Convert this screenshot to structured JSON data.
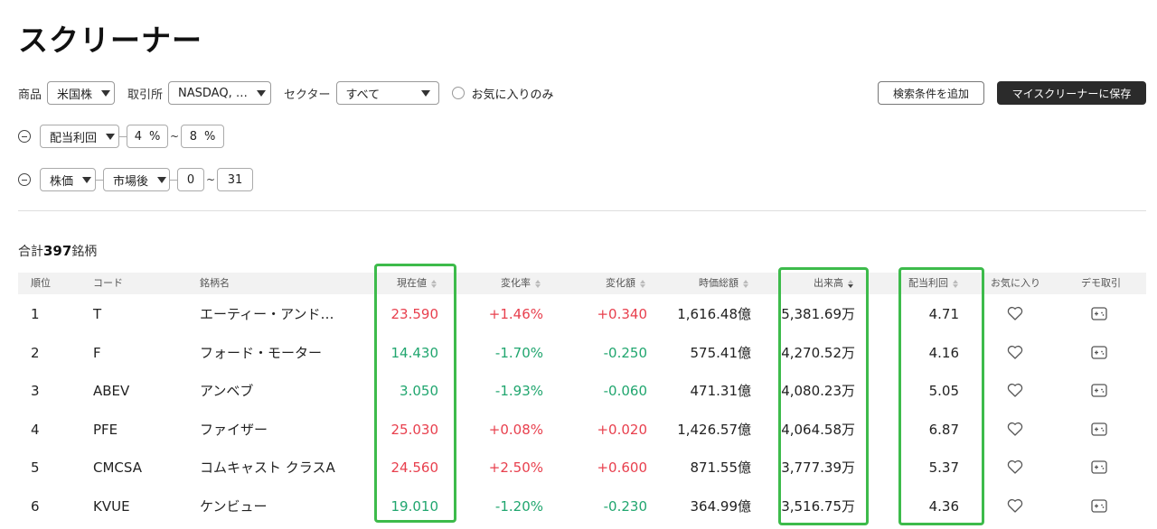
{
  "page_title": "スクリーナー",
  "filters": {
    "product_label": "商品",
    "product_value": "米国株",
    "exchange_label": "取引所",
    "exchange_value": "NASDAQ, …",
    "sector_label": "セクター",
    "sector_value": "すべて",
    "favorites_only_label": "お気に入りのみ"
  },
  "actions": {
    "add_condition": "検索条件を追加",
    "save": "マイスクリーナーに保存"
  },
  "conditions": [
    {
      "field": "配当利回",
      "min": "4",
      "min_unit": "%",
      "sep": "~",
      "max": "8",
      "max_unit": "%"
    },
    {
      "field": "株価",
      "session": "市場後",
      "min": "0",
      "sep": "~",
      "max": "31"
    }
  ],
  "summary": {
    "prefix": "合計",
    "count": "397",
    "suffix": "銘柄"
  },
  "columns": {
    "rank": "順位",
    "code": "コード",
    "name": "銘柄名",
    "price": "現在値",
    "change_pct": "変化率",
    "change_amt": "変化額",
    "market_cap": "時価総額",
    "volume": "出来高",
    "dividend_yield": "配当利回",
    "favorite": "お気に入り",
    "demo_trade": "デモ取引"
  },
  "rows": [
    {
      "rank": "1",
      "code": "T",
      "name": "エーティー・アンド…",
      "price": "23.590",
      "change_pct": "+1.46%",
      "change_amt": "+0.340",
      "market_cap": "1,616.48億",
      "volume": "5,381.69万",
      "dividend_yield": "4.71",
      "direction": "up"
    },
    {
      "rank": "2",
      "code": "F",
      "name": "フォード・モーター",
      "price": "14.430",
      "change_pct": "-1.70%",
      "change_amt": "-0.250",
      "market_cap": "575.41億",
      "volume": "4,270.52万",
      "dividend_yield": "4.16",
      "direction": "down"
    },
    {
      "rank": "3",
      "code": "ABEV",
      "name": "アンベブ",
      "price": "3.050",
      "change_pct": "-1.93%",
      "change_amt": "-0.060",
      "market_cap": "471.31億",
      "volume": "4,080.23万",
      "dividend_yield": "5.05",
      "direction": "down"
    },
    {
      "rank": "4",
      "code": "PFE",
      "name": "ファイザー",
      "price": "25.030",
      "change_pct": "+0.08%",
      "change_amt": "+0.020",
      "market_cap": "1,426.57億",
      "volume": "4,064.58万",
      "dividend_yield": "6.87",
      "direction": "up"
    },
    {
      "rank": "5",
      "code": "CMCSA",
      "name": "コムキャスト クラスA",
      "price": "24.560",
      "change_pct": "+2.50%",
      "change_amt": "+0.600",
      "market_cap": "871.55億",
      "volume": "3,777.39万",
      "dividend_yield": "5.37",
      "direction": "up"
    },
    {
      "rank": "6",
      "code": "KVUE",
      "name": "ケンビュー",
      "price": "19.010",
      "change_pct": "-1.20%",
      "change_amt": "-0.230",
      "market_cap": "364.99億",
      "volume": "3,516.75万",
      "dividend_yield": "4.36",
      "direction": "down"
    }
  ],
  "colors": {
    "up": "#e8404e",
    "down": "#21a66f",
    "highlight": "#3dbb4b",
    "dark_button": "#2b2b2b"
  },
  "icons": {
    "favorite": "heart-icon",
    "demo_trade": "gamepad-icon",
    "remove_condition": "minus-circle-icon"
  }
}
